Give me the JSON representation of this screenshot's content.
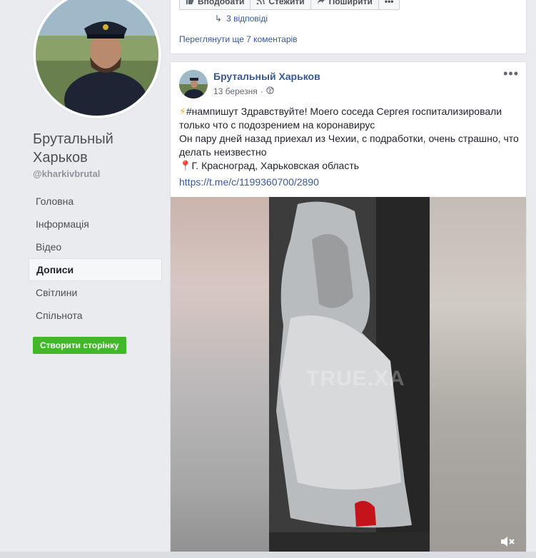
{
  "page": {
    "name": "Брутальный Харьков",
    "handle": "@kharkivbrutal"
  },
  "nav": {
    "items": [
      {
        "label": "Головна"
      },
      {
        "label": "Інформація"
      },
      {
        "label": "Відео"
      },
      {
        "label": "Дописи"
      },
      {
        "label": "Світлини"
      },
      {
        "label": "Спільнота"
      }
    ],
    "active_index": 3
  },
  "create_page_button": "Створити сторінку",
  "prev_post": {
    "actions": [
      "Вподобати",
      "Стежити",
      "Поширити"
    ],
    "replies": "3 відповіді",
    "more_comments": "Переглянути ще 7 коментарів"
  },
  "post": {
    "author": "Брутальный Харьков",
    "date": "13 березня",
    "lines": [
      "#нампишут Здравствуйте! Моего соседа Сергея госпитализировали",
      "только что с подозрением на коронавирус",
      "Он пару дней назад приехал из Чехии, с подработки, очень страшно, что",
      "делать неизвестно",
      "Г. Красноград, Харьковская область"
    ],
    "link": "https://t.me/c/1199360700/2890",
    "watermark": "TRUE.XA"
  },
  "colors": {
    "link": "#385898",
    "button_green": "#42b72a",
    "background": "#e9ebee"
  },
  "icons": [
    "globe-icon",
    "more-icon",
    "mute-icon",
    "lightning-icon",
    "pin-icon",
    "like-icon",
    "follow-icon",
    "share-icon"
  ]
}
